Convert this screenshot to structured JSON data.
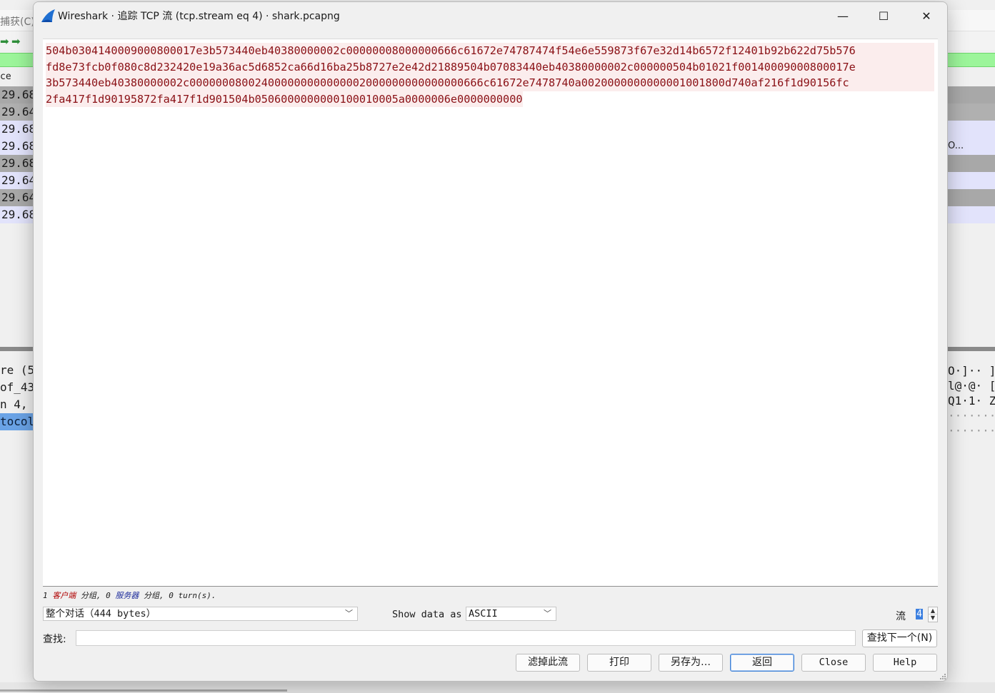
{
  "background_window": {
    "menu_capture": "捕获(C)",
    "column_header": "ce",
    "packet_time_rows": [
      "29.68",
      "29.64",
      "29.68",
      "29.68",
      "29.68",
      "29.64",
      "29.64",
      "29.68"
    ],
    "right_info_text": "O...",
    "detail_rows": [
      "re (5",
      "of_43",
      "n 4,",
      "tocol"
    ],
    "hex_ascii_rows": [
      "O·]·· ]",
      "l@·@· [",
      "Q1·1· Z",
      "·······",
      "·······"
    ]
  },
  "dialog": {
    "title": "Wireshark · 追踪 TCP 流 (tcp.stream eq 4) · shark.pcapng",
    "window_controls": {
      "minimize_glyph": "—",
      "maximize_glyph": "☐",
      "close_glyph": "✕"
    },
    "stream_lines": [
      "504b0304140009000800017e3b573440eb40380000002c00000008000000666c61672e74787474f54e6e559873f67e32d14b6572f12401b92b622d75b576",
      "fd8e73fcb0f080c8d232420e19a36ac5d6852ca66d16ba25b8727e2e42d21889504b07083440eb40380000002c000000504b01021f00140009000800017e",
      "3b573440eb40380000002c000000080024000000000000002000000000000000666c61672e7478740a0020000000000001001800d740af216f1d90156fc",
      "2fa417f1d90195872fa417f1d901504b0506000000000100010005a0000006e0000000000"
    ],
    "status": {
      "client_count": "1",
      "client_word": "客户端",
      "packets_word_1": "分组,",
      "server_count": "0",
      "server_word": "服务器",
      "packets_word_2": "分组,",
      "turns_text": "0 turn(s)."
    },
    "conversation_select": "整个对话（444 bytes）",
    "show_data_label": "Show data as",
    "show_data_select": "ASCII",
    "stream_label": "流",
    "stream_number": "4",
    "find_label": "查找:",
    "find_value": "",
    "find_next_button": "查找下一个(N)",
    "buttons": {
      "filter_out": "滤掉此流",
      "print": "打印",
      "save_as": "另存为…",
      "back": "返回",
      "close": "Close",
      "help": "Help"
    }
  },
  "colors": {
    "client_text": "#8a1015",
    "client_background": "#fbeded",
    "display_filter_green": "#9cf59a",
    "selected_row_blue": "#6aa3e6"
  }
}
